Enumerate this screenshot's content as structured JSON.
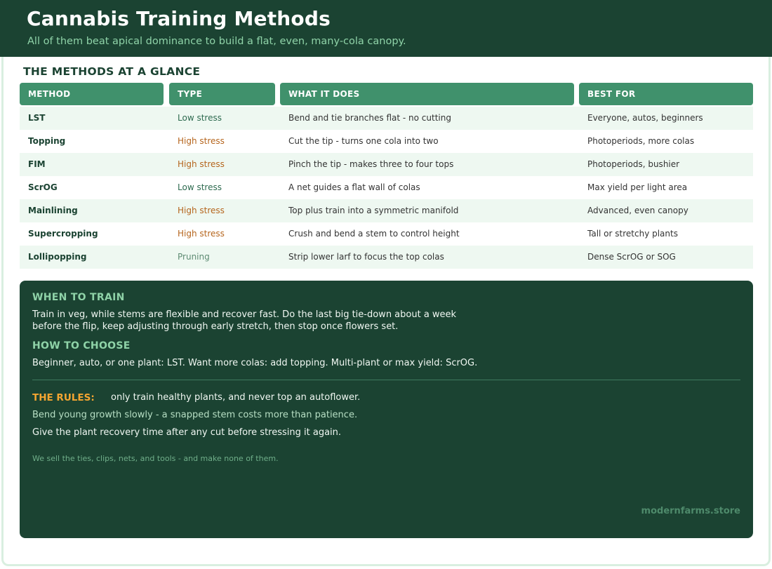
{
  "header": {
    "title": "Cannabis Training Methods",
    "subtitle": "All of them beat apical dominance to build a flat, even, many-cola canopy."
  },
  "table": {
    "heading": "THE METHODS AT A GLANCE",
    "columns": [
      "METHOD",
      "TYPE",
      "WHAT IT DOES",
      "BEST FOR"
    ],
    "rows": [
      {
        "method": "LST",
        "type": "Low stress",
        "type_kind": "low",
        "does": "Bend and tie branches flat - no cutting",
        "best": "Everyone, autos, beginners"
      },
      {
        "method": "Topping",
        "type": "High stress",
        "type_kind": "high",
        "does": "Cut the tip - turns one cola into two",
        "best": "Photoperiods, more colas"
      },
      {
        "method": "FIM",
        "type": "High stress",
        "type_kind": "high",
        "does": "Pinch the tip - makes three to four tops",
        "best": "Photoperiods, bushier"
      },
      {
        "method": "ScrOG",
        "type": "Low stress",
        "type_kind": "low",
        "does": "A net guides a flat wall of colas",
        "best": "Max yield per light area"
      },
      {
        "method": "Mainlining",
        "type": "High stress",
        "type_kind": "high",
        "does": "Top plus train into a symmetric manifold",
        "best": "Advanced, even canopy"
      },
      {
        "method": "Supercropping",
        "type": "High stress",
        "type_kind": "high",
        "does": "Crush and bend a stem to control height",
        "best": "Tall or stretchy plants"
      },
      {
        "method": "Lollipopping",
        "type": "Pruning",
        "type_kind": "prune",
        "does": "Strip lower larf to focus the top colas",
        "best": "Dense ScrOG or SOG"
      }
    ]
  },
  "panel": {
    "when_heading": "WHEN TO TRAIN",
    "when_line1": "Train in veg, while stems are flexible and recover fast. Do the last big tie-down about a week",
    "when_line2": "before the flip, keep adjusting through early stretch, then stop once flowers set.",
    "choose_heading": "HOW TO CHOOSE",
    "choose_text": "Beginner, auto, or one plant: LST. Want more colas: add topping. Multi-plant or max yield: ScrOG.",
    "rules_label": "THE RULES:",
    "rules_text": "only train healthy plants, and never top an autoflower.",
    "rule2": "Bend young growth slowly - a snapped stem costs more than patience.",
    "rule3": "Give the plant recovery time after any cut before stressing it again.",
    "footer_note": "We sell the ties, clips, nets, and tools - and make none of them.",
    "brand": "modernfarms.store"
  },
  "colors": {
    "dark_green": "#1b4332",
    "header_green": "#40916c",
    "light_green_text": "#8fd3a8",
    "high_stress": "#b5651d",
    "rules_accent": "#f4a531"
  }
}
